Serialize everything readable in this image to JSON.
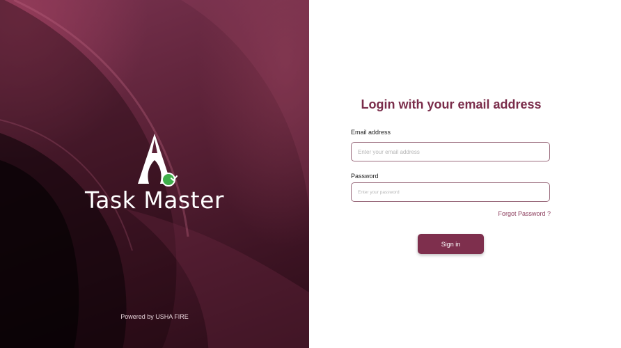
{
  "brand": {
    "name": "Task Master",
    "powered_by": "Powered by USHA FIRE"
  },
  "login": {
    "title": "Login with your email address",
    "email_label": "Email address",
    "email_placeholder": "Enter your email address",
    "password_label": "Password",
    "password_placeholder": "Enter your password",
    "forgot_password": "Forgot Password ?",
    "sign_in": "Sign in"
  },
  "colors": {
    "accent": "#7e2f4d",
    "panel_dark": "#4a1a2d",
    "check_green": "#3fae4a"
  }
}
